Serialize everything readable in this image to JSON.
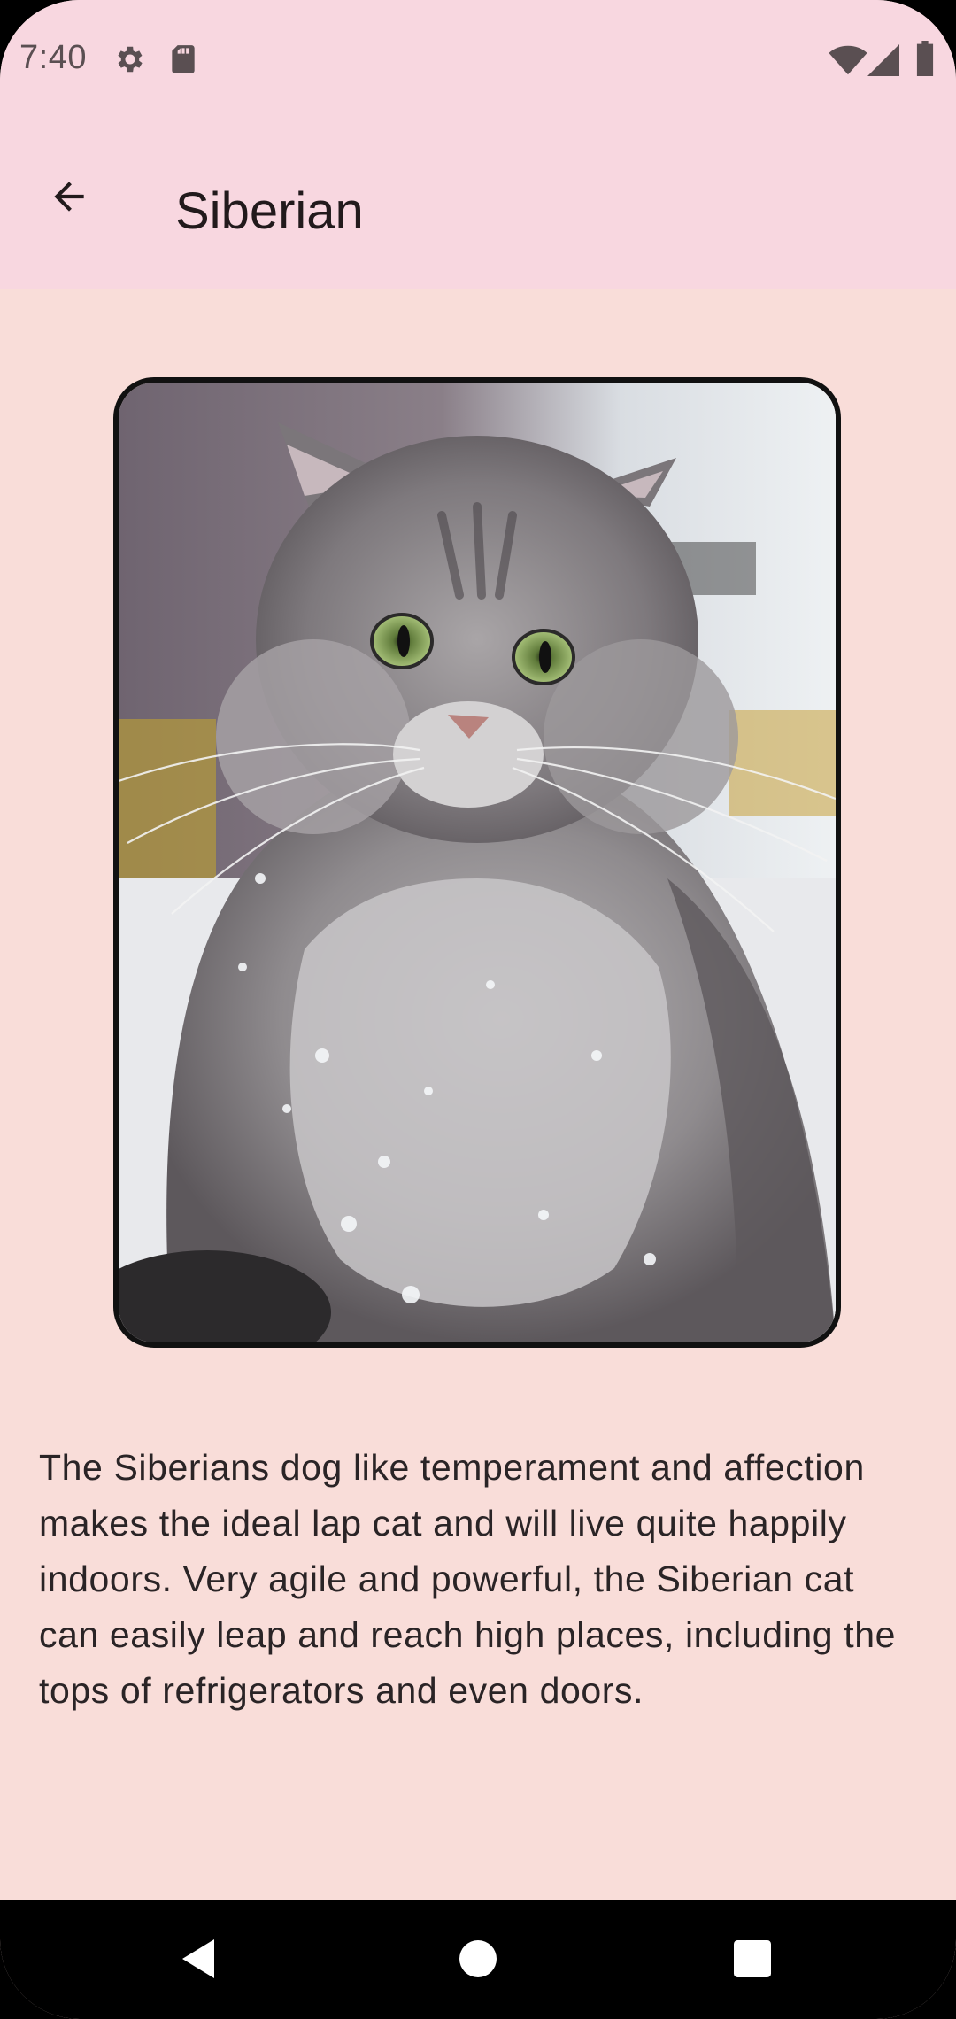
{
  "status_bar": {
    "time": "7:40",
    "left_icons": [
      "gear-icon",
      "sd-card-icon"
    ],
    "right_icons": [
      "wifi-icon",
      "signal-icon",
      "battery-icon"
    ]
  },
  "app_bar": {
    "back_icon": "arrow-left-icon",
    "title": "Siberian"
  },
  "main": {
    "image_subject": "siberian-cat-photo",
    "description": "The Siberians dog like temperament and affection makes the ideal lap cat and will live quite happily indoors. Very agile and powerful, the Siberian cat can easily leap and reach high places, including the tops of refrigerators and even doors."
  },
  "nav_bar": {
    "buttons": [
      "back-triangle-icon",
      "home-circle-icon",
      "recents-square-icon"
    ]
  },
  "colors": {
    "app_bar_bg": "#f8d7e0",
    "content_bg": "#f9ddd9",
    "text": "#221a1c",
    "nav_bg": "#000000"
  }
}
